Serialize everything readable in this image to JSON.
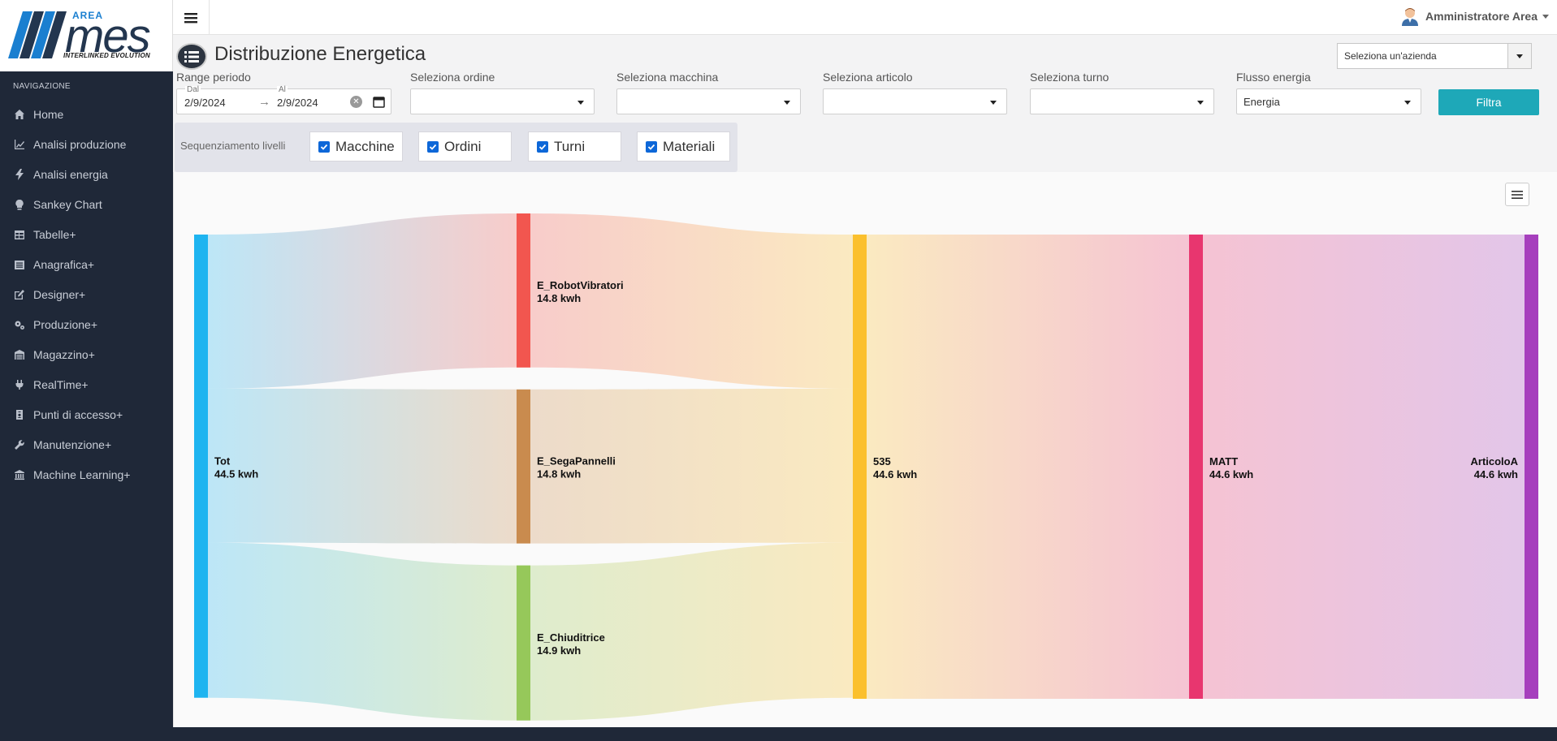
{
  "brand": {
    "area": "AREA",
    "mes": "mes",
    "tagline": "INTERLINKED EVOLUTION"
  },
  "sidebar": {
    "header": "NAVIGAZIONE",
    "items": [
      {
        "label": "Home",
        "icon": "home-icon"
      },
      {
        "label": "Analisi produzione",
        "icon": "line-chart-icon"
      },
      {
        "label": "Analisi energia",
        "icon": "bolt-icon"
      },
      {
        "label": "Sankey Chart",
        "icon": "lightbulb-icon"
      },
      {
        "label": "Tabelle+",
        "icon": "table-icon"
      },
      {
        "label": "Anagrafica+",
        "icon": "list-icon"
      },
      {
        "label": "Designer+",
        "icon": "edit-icon"
      },
      {
        "label": "Produzione+",
        "icon": "gears-icon"
      },
      {
        "label": "Magazzino+",
        "icon": "warehouse-icon"
      },
      {
        "label": "RealTime+",
        "icon": "plug-icon"
      },
      {
        "label": "Punti di accesso+",
        "icon": "badge-icon"
      },
      {
        "label": "Manutenzione+",
        "icon": "wrench-icon"
      },
      {
        "label": "Machine Learning+",
        "icon": "university-icon"
      }
    ]
  },
  "topbar": {
    "user_name": "Amministratore Area"
  },
  "page": {
    "title": "Distribuzione Energetica"
  },
  "company_select": {
    "placeholder": "Seleziona un'azienda"
  },
  "filters": {
    "range_label": "Range periodo",
    "from_label": "Dal",
    "to_label": "Al",
    "from_value": "2/9/2024",
    "to_value": "2/9/2024",
    "arrow": "→",
    "clear": "✕",
    "ordine_label": "Seleziona ordine",
    "ordine_value": "",
    "macchina_label": "Seleziona macchina",
    "macchina_value": "",
    "articolo_label": "Seleziona articolo",
    "articolo_value": "",
    "turno_label": "Seleziona turno",
    "turno_value": "",
    "flusso_label": "Flusso energia",
    "flusso_value": "Energia",
    "button": "Filtra"
  },
  "sequence": {
    "label": "Sequenziamento livelli",
    "items": [
      {
        "label": "Macchine",
        "checked": true
      },
      {
        "label": "Ordini",
        "checked": true
      },
      {
        "label": "Turni",
        "checked": true
      },
      {
        "label": "Materiali",
        "checked": true
      }
    ]
  },
  "chart_data": {
    "type": "sankey",
    "nodes": [
      {
        "id": "Tot",
        "name": "Tot",
        "value_label": "44.5 kwh",
        "value": 44.5,
        "column": 0,
        "color": "#1eb4f0"
      },
      {
        "id": "E_RobotVibratori",
        "name": "E_RobotVibratori",
        "value_label": "14.8 kwh",
        "value": 14.8,
        "column": 1,
        "color": "#f2564f"
      },
      {
        "id": "E_SegaPannelli",
        "name": "E_SegaPannelli",
        "value_label": "14.8 kwh",
        "value": 14.8,
        "column": 1,
        "color": "#c98b4e"
      },
      {
        "id": "E_Chiuditrice",
        "name": "E_Chiuditrice",
        "value_label": "14.9 kwh",
        "value": 14.9,
        "column": 1,
        "color": "#96c85a"
      },
      {
        "id": "535",
        "name": "535",
        "value_label": "44.6 kwh",
        "value": 44.6,
        "column": 2,
        "color": "#fbc02d"
      },
      {
        "id": "MATT",
        "name": "MATT",
        "value_label": "44.6 kwh",
        "value": 44.6,
        "column": 3,
        "color": "#e8366f"
      },
      {
        "id": "ArticoloA",
        "name": "ArticoloA",
        "value_label": "44.6 kwh",
        "value": 44.6,
        "column": 4,
        "color": "#a63fbd"
      }
    ],
    "links": [
      {
        "source": "Tot",
        "target": "E_RobotVibratori",
        "value": 14.8
      },
      {
        "source": "Tot",
        "target": "E_SegaPannelli",
        "value": 14.8
      },
      {
        "source": "Tot",
        "target": "E_Chiuditrice",
        "value": 14.9
      },
      {
        "source": "E_RobotVibratori",
        "target": "535",
        "value": 14.8
      },
      {
        "source": "E_SegaPannelli",
        "target": "535",
        "value": 14.8
      },
      {
        "source": "E_Chiuditrice",
        "target": "535",
        "value": 14.9
      },
      {
        "source": "535",
        "target": "MATT",
        "value": 44.6
      },
      {
        "source": "MATT",
        "target": "ArticoloA",
        "value": 44.6
      }
    ]
  }
}
